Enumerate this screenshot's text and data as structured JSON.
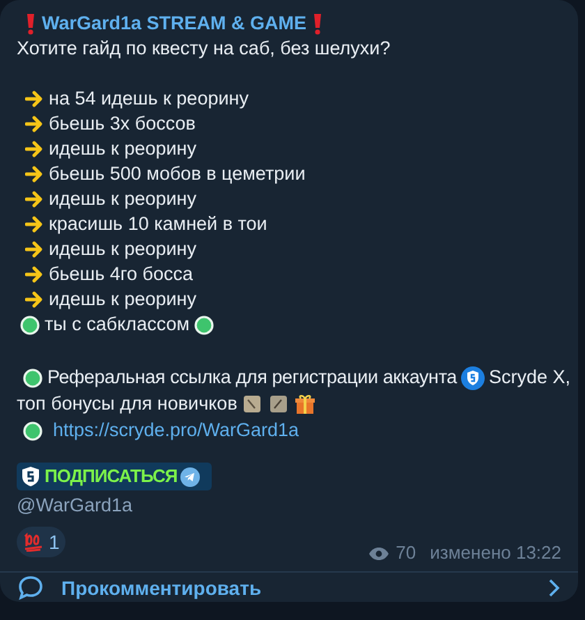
{
  "channel_title": "WarGard1a STREAM & GAME",
  "question": "Хотите гайд по квесту на саб, без шелухи?",
  "steps": [
    "на 54 идешь к реорину",
    "бьешь 3х боссов",
    "идешь к реорину",
    "бьешь 500 мобов в цеметрии",
    "идешь к реорину",
    "красишь 10 камней в тои",
    "идешь к реорину",
    "бьешь 4го босса",
    "идешь к реорину"
  ],
  "result": "ты с сабклассом",
  "referral": {
    "text": "Реферальная ссылка для регистрации аккаунта",
    "brand": "Scryde X,",
    "bonus": "топ бонусы для новичков",
    "link": "https://scryde.pro/WarGard1a"
  },
  "subscribe": {
    "label": "ПОДПИСАТЬСЯ",
    "handle": "@WarGard1a"
  },
  "reactions": [
    {
      "count": "1",
      "selected": false
    }
  ],
  "views": "70",
  "edited": "изменено 13:22",
  "comment": "Прокомментировать"
}
